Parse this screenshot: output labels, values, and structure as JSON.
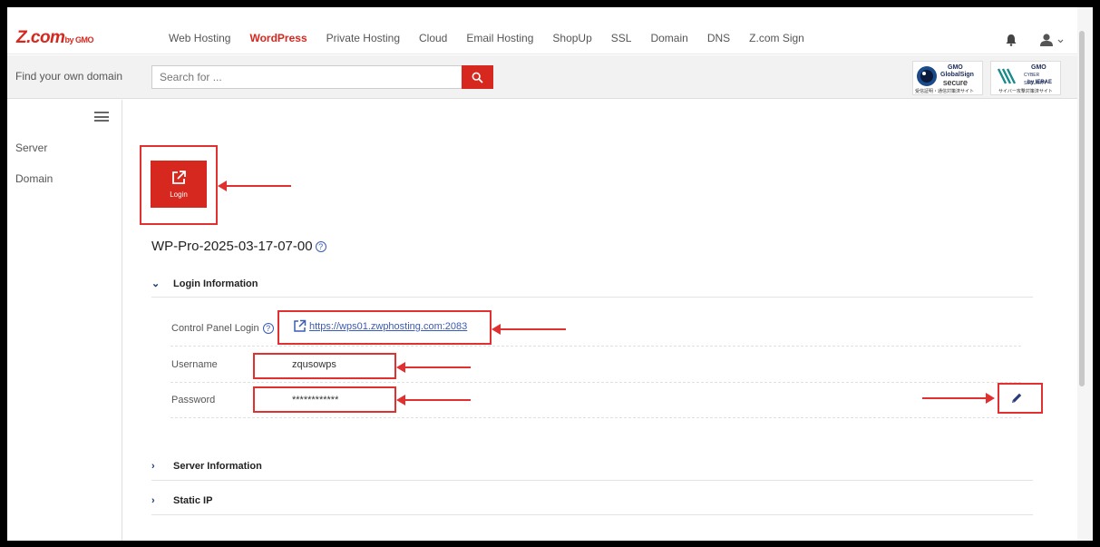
{
  "brand": {
    "logo_main": "Z.com",
    "logo_sub": "by GMO"
  },
  "nav": {
    "items": [
      {
        "label": "Web Hosting",
        "active": false
      },
      {
        "label": "WordPress",
        "active": true
      },
      {
        "label": "Private Hosting",
        "active": false
      },
      {
        "label": "Cloud",
        "active": false
      },
      {
        "label": "Email Hosting",
        "active": false
      },
      {
        "label": "ShopUp",
        "active": false
      },
      {
        "label": "SSL",
        "active": false
      },
      {
        "label": "Domain",
        "active": false
      },
      {
        "label": "DNS",
        "active": false
      },
      {
        "label": "Z.com Sign",
        "active": false
      }
    ],
    "icons": [
      "bell-icon",
      "user-icon"
    ]
  },
  "search": {
    "label": "Find your own domain",
    "placeholder": "Search for ..."
  },
  "badges": {
    "globalsign": {
      "brand": "GMO",
      "line1": "GlobalSign",
      "line2": "secure",
      "small": "受信証明・通信対策済サイト"
    },
    "ierae": {
      "brand": "GMO",
      "line1": "CYBER SECURITY",
      "line2": "by IERAE",
      "small": "サイバー攻撃対策済サイト"
    }
  },
  "sidebar": {
    "items": [
      {
        "label": "Server"
      },
      {
        "label": "Domain"
      }
    ]
  },
  "main": {
    "login_tile_label": "Login",
    "title": "WP-Pro-2025-03-17-07-00",
    "sections": {
      "login_info": "Login Information",
      "server_info": "Server Information",
      "static_ip": "Static IP"
    },
    "fields": {
      "control_panel_label": "Control Panel Login",
      "control_panel_url": "https://wps01.zwphosting.com:2083",
      "username_label": "Username",
      "username_value": "zqusowps",
      "password_label": "Password",
      "password_value": "************"
    }
  },
  "colors": {
    "accent": "#d6281f",
    "link": "#3b5bb5",
    "annotation": "#e03030"
  }
}
